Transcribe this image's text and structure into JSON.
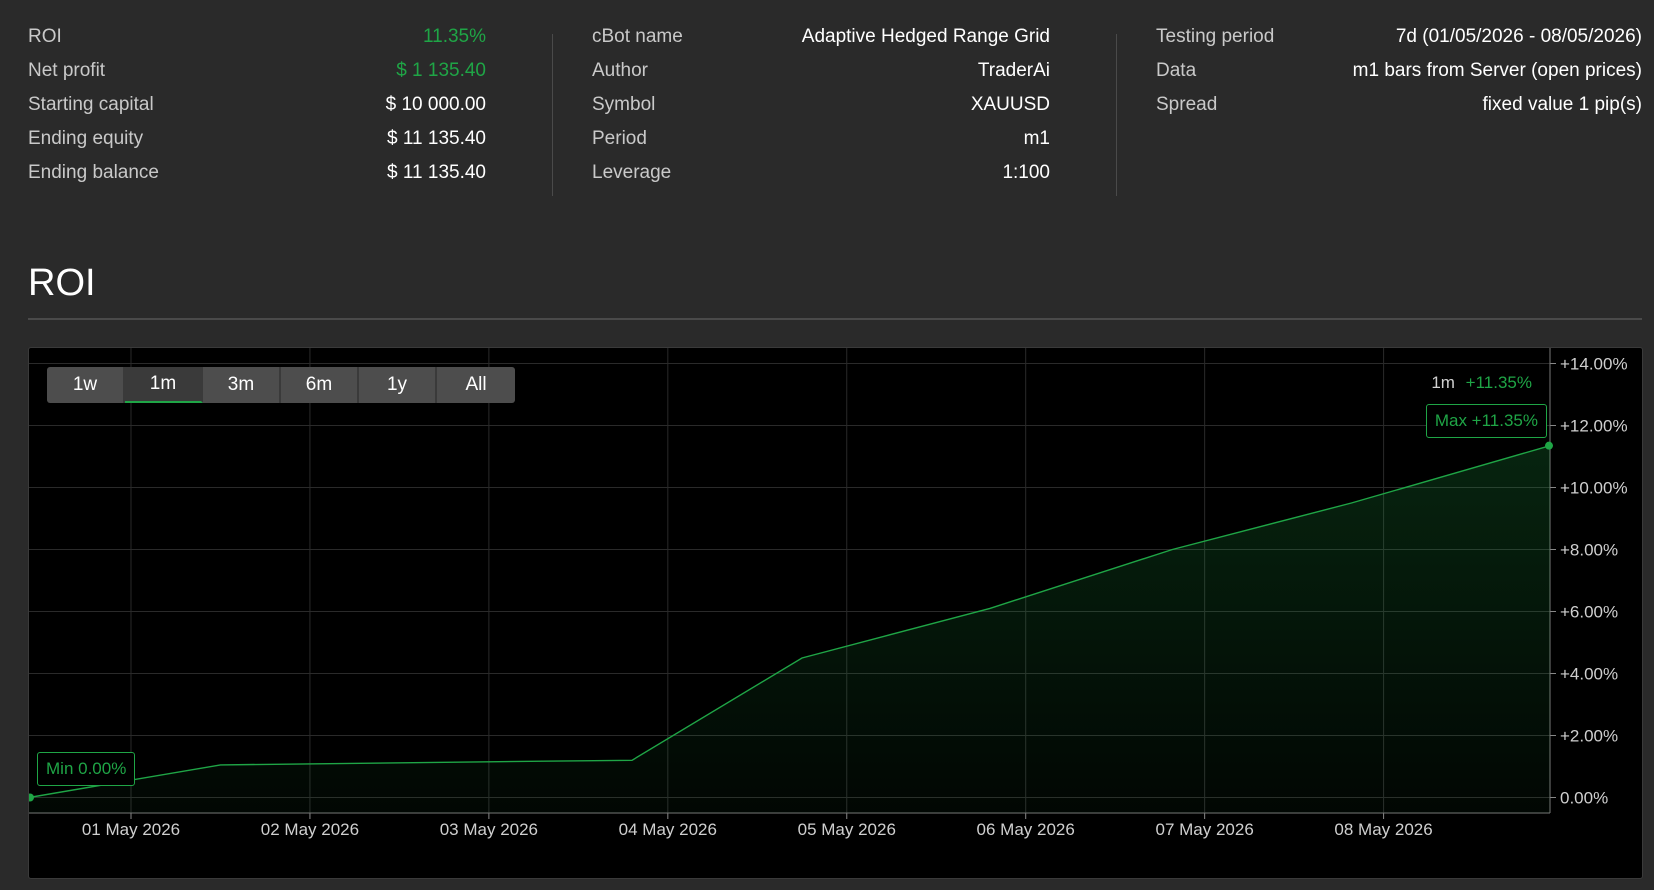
{
  "stats": {
    "col1": [
      {
        "label": "ROI",
        "value": "11.35%",
        "green": true
      },
      {
        "label": "Net profit",
        "value": "$ 1 135.40",
        "green": true
      },
      {
        "label": "Starting capital",
        "value": "$ 10 000.00",
        "green": false
      },
      {
        "label": "Ending equity",
        "value": "$ 11 135.40",
        "green": false
      },
      {
        "label": "Ending balance",
        "value": "$ 11 135.40",
        "green": false
      }
    ],
    "col2": [
      {
        "label": "cBot name",
        "value": "Adaptive Hedged Range Grid"
      },
      {
        "label": "Author",
        "value": "TraderAi"
      },
      {
        "label": "Symbol",
        "value": "XAUUSD"
      },
      {
        "label": "Period",
        "value": "m1"
      },
      {
        "label": "Leverage",
        "value": "1:100"
      }
    ],
    "col3": [
      {
        "label": "Testing period",
        "value": "7d (01/05/2026 - 08/05/2026)"
      },
      {
        "label": "Data",
        "value": "m1 bars from Server (open prices)"
      },
      {
        "label": "Spread",
        "value": "fixed value 1 pip(s)"
      }
    ]
  },
  "section_title": "ROI",
  "range_buttons": [
    {
      "label": "1w",
      "active": false
    },
    {
      "label": "1m",
      "active": true
    },
    {
      "label": "3m",
      "active": false
    },
    {
      "label": "6m",
      "active": false
    },
    {
      "label": "1y",
      "active": false
    },
    {
      "label": "All",
      "active": false
    }
  ],
  "selection": {
    "period": "1m",
    "value": "+11.35%"
  },
  "tags": {
    "max": "Max +11.35%",
    "min": "Min 0.00%"
  },
  "colors": {
    "accent": "#1fa546",
    "panel": "#2a2a2a",
    "chart_bg": "#000000"
  },
  "chart_data": {
    "type": "area",
    "title": "ROI",
    "xlabel": "",
    "ylabel": "",
    "x_ticks": [
      "01 May 2026",
      "02 May 2026",
      "03 May 2026",
      "04 May 2026",
      "05 May 2026",
      "06 May 2026",
      "07 May 2026",
      "08 May 2026"
    ],
    "y_ticks": [
      "0.00%",
      "+2.00%",
      "+4.00%",
      "+6.00%",
      "+8.00%",
      "+10.00%",
      "+12.00%",
      "+14.00%"
    ],
    "ylim": [
      -0.5,
      14.5
    ],
    "xlim": [
      30.43,
      38.93
    ],
    "grid": true,
    "series": [
      {
        "x": [
          30.43,
          31.5,
          33.3,
          33.8,
          34.75,
          35.8,
          36.82,
          37.82,
          38.93
        ],
        "y": [
          0.0,
          1.05,
          1.17,
          1.2,
          4.5,
          6.1,
          8.0,
          9.5,
          11.35
        ]
      }
    ]
  }
}
